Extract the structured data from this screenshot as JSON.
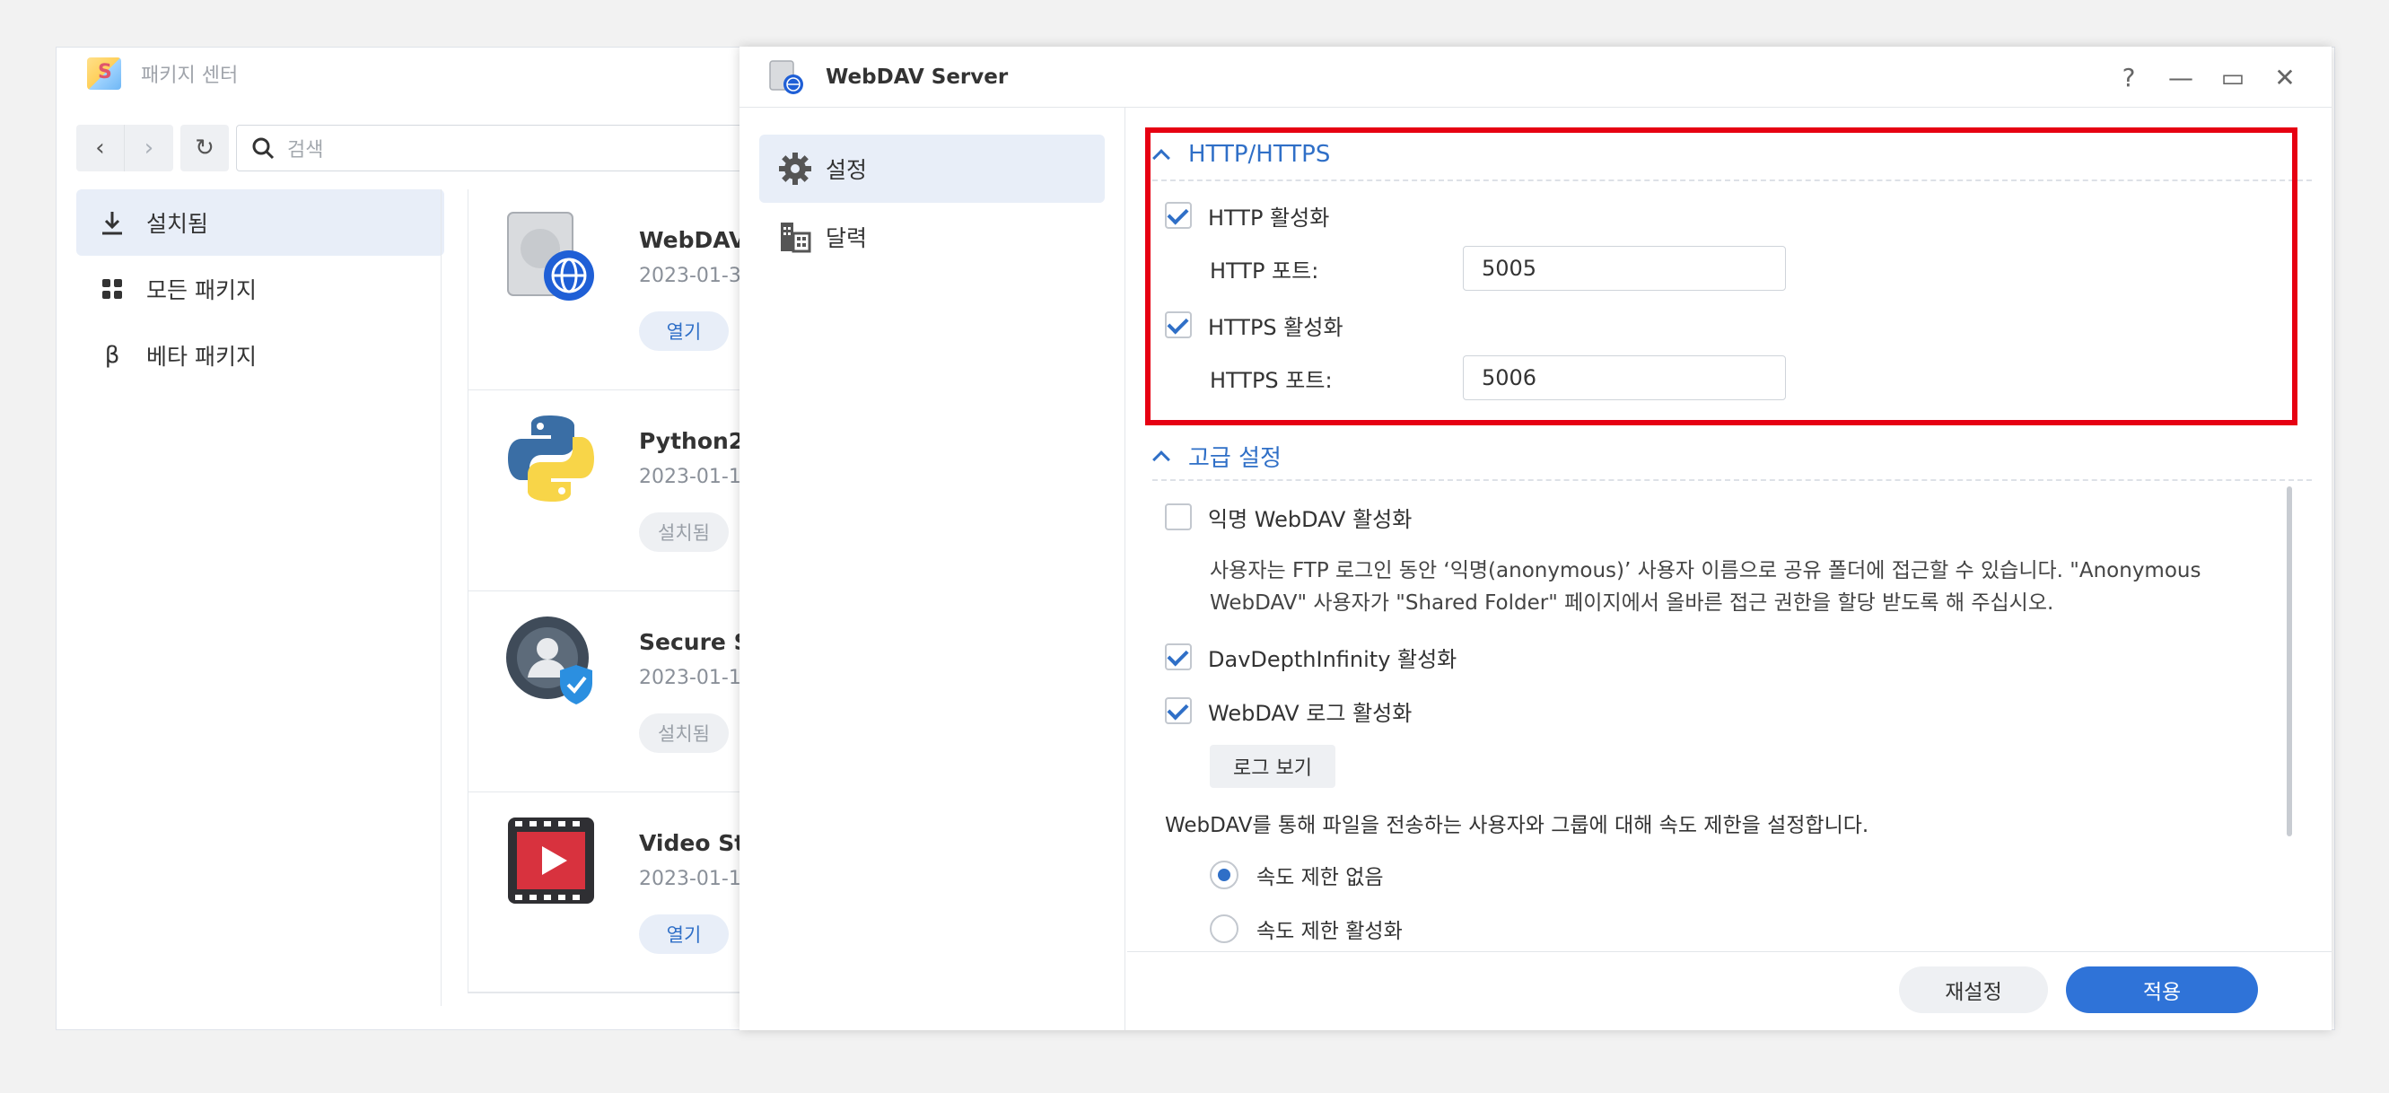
{
  "package_center": {
    "title": "패키지 센터",
    "search_placeholder": "검색",
    "sidebar": [
      {
        "label": "설치됨",
        "icon": "download-icon"
      },
      {
        "label": "모든 패키지",
        "icon": "grid-icon"
      },
      {
        "label": "베타 패키지",
        "icon": "beta-icon"
      }
    ],
    "packages": [
      {
        "title": "WebDAV",
        "date": "2023-01-3",
        "button": "열기",
        "icon": "webdav-globe-icon"
      },
      {
        "title": "Python2",
        "date": "2023-01-1",
        "button": "설치됨",
        "icon": "python-icon"
      },
      {
        "title": "Secure Si",
        "date": "2023-01-1",
        "button": "설치됨",
        "icon": "secure-signin-icon"
      },
      {
        "title": "Video Sta",
        "date": "2023-01-1",
        "button": "열기",
        "icon": "video-station-icon"
      }
    ]
  },
  "dialog": {
    "title": "WebDAV Server",
    "controls": {
      "help": "?",
      "minimize": "—",
      "maximize": "▭",
      "close": "✕"
    },
    "nav": [
      {
        "label": "설정",
        "icon": "gear-icon"
      },
      {
        "label": "달력",
        "icon": "calendar-icon"
      }
    ],
    "http_section": {
      "title": "HTTP/HTTPS",
      "http_enable": {
        "label": "HTTP 활성화",
        "checked": true
      },
      "http_port": {
        "label": "HTTP 포트:",
        "value": "5005"
      },
      "https_enable": {
        "label": "HTTPS 활성화",
        "checked": true
      },
      "https_port": {
        "label": "HTTPS 포트:",
        "value": "5006"
      }
    },
    "advanced_section": {
      "title": "고급 설정",
      "anonymous": {
        "label": "익명 WebDAV 활성화",
        "checked": false
      },
      "anonymous_desc": "사용자는 FTP 로그인 동안 ‘익명(anonymous)’ 사용자 이름으로 공유 폴더에 접근할 수 있습니다. \"Anonymous WebDAV\" 사용자가 \"Shared Folder\" 페이지에서 올바른 접근 권한을 할당 받도록 해 주십시오.",
      "depth_infinity": {
        "label": "DavDepthInfinity 활성화",
        "checked": true
      },
      "log_enable": {
        "label": "WebDAV 로그 활성화",
        "checked": true
      },
      "view_log_button": "로그 보기",
      "speed_desc": "WebDAV를 통해 파일을 전송하는 사용자와 그룹에 대해 속도 제한을 설정합니다.",
      "speed_none": {
        "label": "속도 제한 없음",
        "selected": true
      },
      "speed_enable": {
        "label": "속도 제한 활성화",
        "selected": false
      }
    },
    "footer": {
      "reset": "재설정",
      "apply": "적용"
    }
  },
  "colors": {
    "accent": "#2f73d8",
    "highlight_border": "#e60012",
    "link_blue": "#2f6fc7"
  }
}
